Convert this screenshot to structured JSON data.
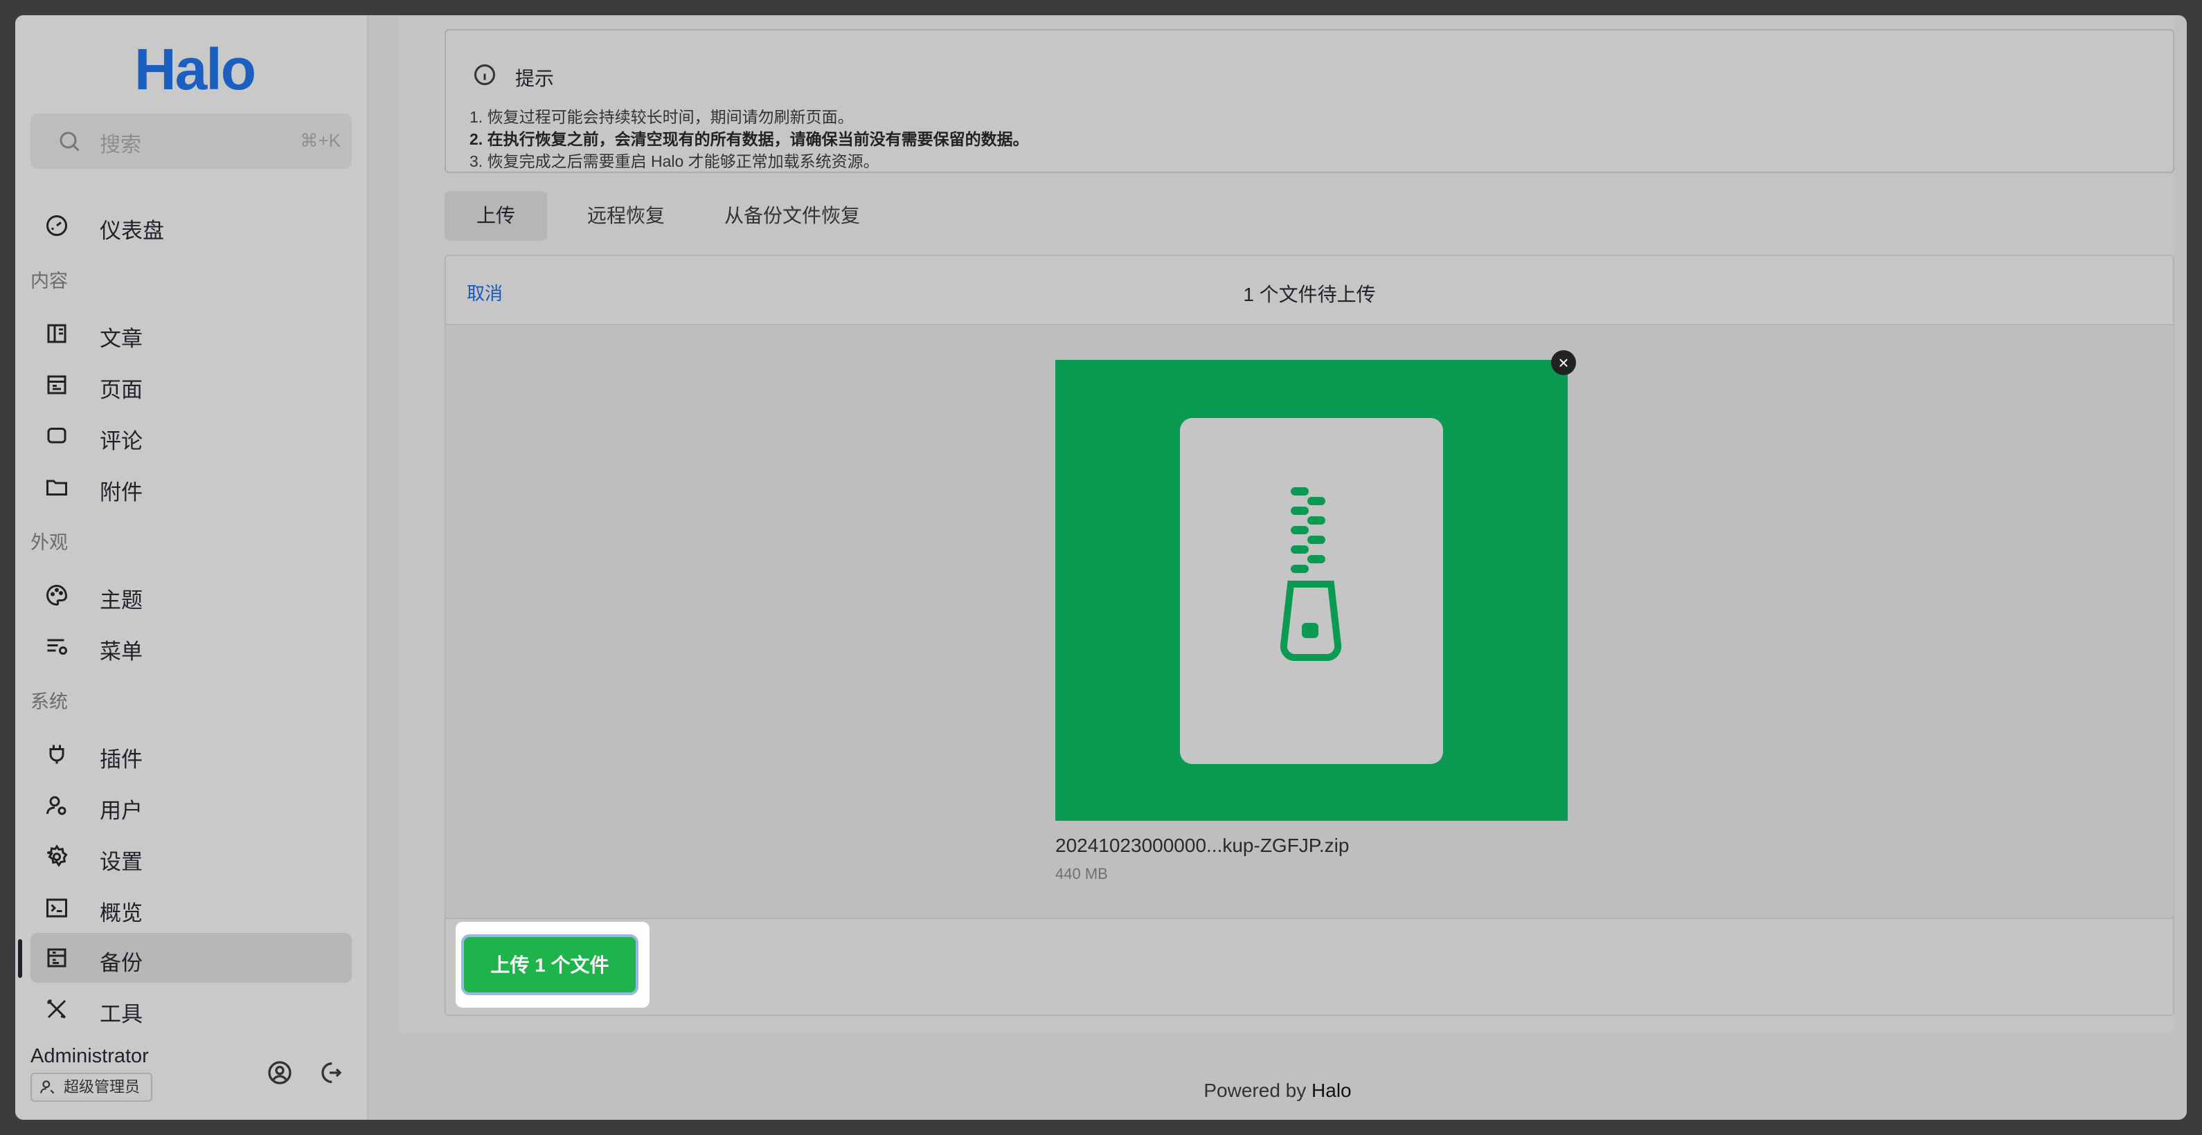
{
  "sidebar": {
    "logo": "Halo",
    "search": {
      "placeholder": "搜索",
      "shortcut": "⌘+K"
    },
    "dashboard": "仪表盘",
    "groups": {
      "content": "内容",
      "appearance": "外观",
      "system": "系统"
    },
    "items": {
      "posts": "文章",
      "pages": "页面",
      "comments": "评论",
      "attachments": "附件",
      "themes": "主题",
      "menus": "菜单",
      "plugins": "插件",
      "users": "用户",
      "settings": "设置",
      "overview": "概览",
      "backup": "备份",
      "tools": "工具"
    },
    "active_item": "backup",
    "user": {
      "name": "Administrator",
      "role": "超级管理员"
    }
  },
  "alert": {
    "title": "提示",
    "lines": [
      "1. 恢复过程可能会持续较长时间，期间请勿刷新页面。",
      "2. 在执行恢复之前，会清空现有的所有数据，请确保当前没有需要保留的数据。",
      "3. 恢复完成之后需要重启 Halo 才能够正常加载系统资源。"
    ]
  },
  "tabs": [
    "上传",
    "远程恢复",
    "从备份文件恢复"
  ],
  "active_tab": 0,
  "uploader": {
    "cancel": "取消",
    "status": "1 个文件待上传",
    "file": {
      "name": "20241023000000...kup-ZGFJP.zip",
      "size": "440 MB"
    },
    "submit": "上传 1 个文件",
    "remove_symbol": "×"
  },
  "footer": {
    "prefix": "Powered by",
    "brand": "Halo"
  },
  "colors": {
    "accent": "#1b5fc1",
    "file_bg": "#0a9a52",
    "button": "#1fb34b"
  }
}
